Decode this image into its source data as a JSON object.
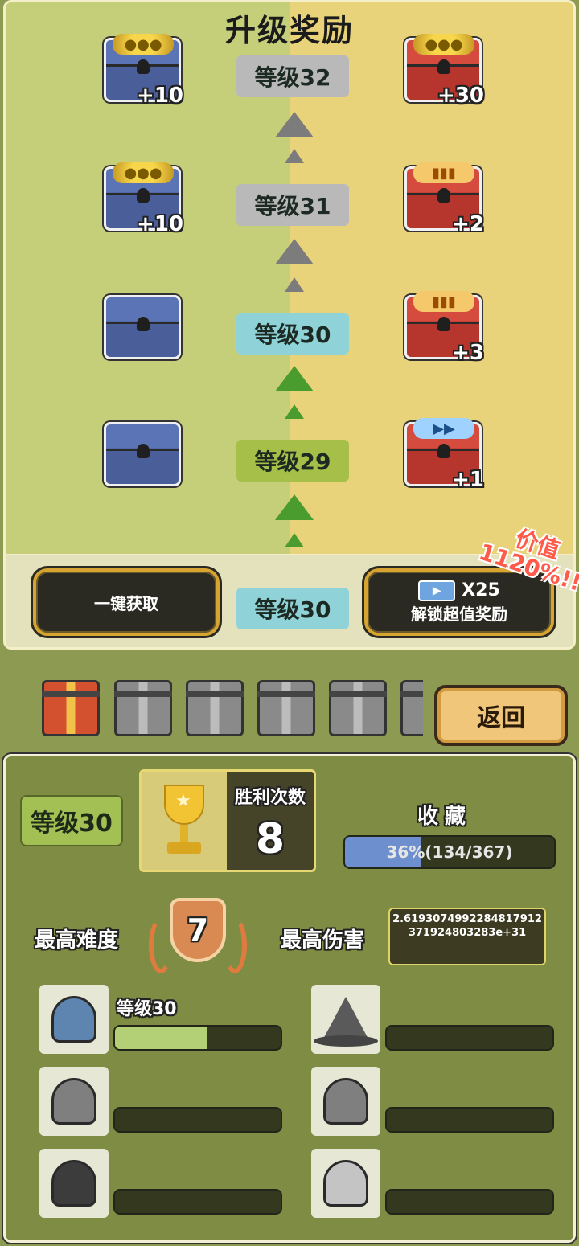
{
  "reward_panel": {
    "title": "升级奖励",
    "rows": [
      {
        "level": "等级32",
        "badge_color": "#b9b9b9",
        "free": {
          "type": "gold",
          "count": "+10"
        },
        "premium": {
          "type": "gold",
          "count": "+30"
        }
      },
      {
        "level": "等级31",
        "badge_color": "#b9b9b9",
        "free": {
          "type": "gold",
          "count": "+10"
        },
        "premium": {
          "type": "card",
          "count": "+2"
        }
      },
      {
        "level": "等级30",
        "badge_color": "#8fd3d8",
        "free": {
          "type": "empty",
          "count": ""
        },
        "premium": {
          "type": "card",
          "count": "+3"
        }
      },
      {
        "level": "等级29",
        "badge_color": "#a5bf48",
        "free": {
          "type": "empty",
          "count": ""
        },
        "premium": {
          "type": "ticket",
          "count": "+1"
        }
      }
    ],
    "collect_all_label": "一键获取",
    "current_level": "等级30",
    "unlock": {
      "multiplier": "X25",
      "label": "解锁超值奖励",
      "value_tag_line1": "价值",
      "value_tag_line2": "1120%!!"
    }
  },
  "gifts": {
    "open_count": 1,
    "locked_count": 5
  },
  "back_label": "返回",
  "stats": {
    "level": "等级30",
    "victory_label": "胜利次数",
    "victory_count": "8",
    "collection_label": "收藏",
    "collection_progress_text": "36%(134/367)",
    "collection_fraction": 0.36,
    "difficulty_label": "最高难度",
    "difficulty_value": "7",
    "damage_label": "最高伤害",
    "damage_value": "2.6193074992284817912371924803283e+31",
    "heroes": [
      {
        "icon": "knight-helmet-icon",
        "level": "等级30",
        "progress": 0.56,
        "unlocked": true
      },
      {
        "icon": "wizard-hat-icon",
        "level": "",
        "progress": 0,
        "unlocked": false
      },
      {
        "icon": "turban-icon",
        "level": "",
        "progress": 0,
        "unlocked": false
      },
      {
        "icon": "hood-icon",
        "level": "",
        "progress": 0,
        "unlocked": false
      },
      {
        "icon": "dark-cowl-icon",
        "level": "",
        "progress": 0,
        "unlocked": false
      },
      {
        "icon": "leaf-crown-icon",
        "level": "",
        "progress": 0,
        "unlocked": false
      }
    ]
  }
}
